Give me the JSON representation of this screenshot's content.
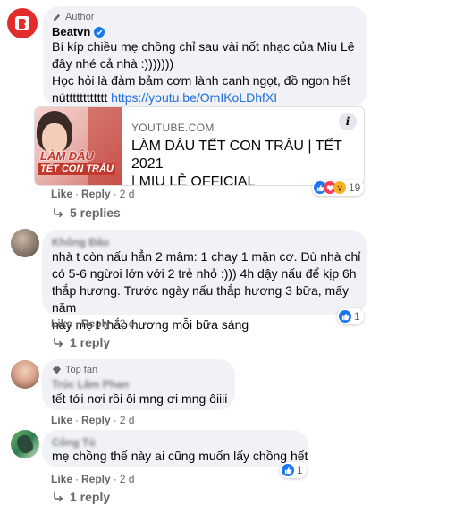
{
  "comment1": {
    "badge": "Author",
    "name": "Beatvn",
    "line1": "Bí kíp chiều mẹ chồng chỉ sau vài nốt nhạc của Miu Lê",
    "line2": "đây nhé cả nhà :)))))))",
    "line3": "Học hỏi là đảm bảm cơm lành canh ngọt, đồ ngon hết",
    "line4_prefix": "nútttttttttttt ",
    "link": "https://youtu.be/OmIKoLDhfXI",
    "preview": {
      "thumb_text_line1": "LÀM DÂU",
      "thumb_text_line2": "TẾT CON TRÂU",
      "domain": "YOUTUBE.COM",
      "title_line1": "LÀM DÂU TẾT CON TRÂU | TẾT 2021",
      "title_line2": "| MIU LÊ OFFICIAL",
      "info_glyph": "i"
    },
    "like": "Like",
    "reply": "Reply",
    "time": "2 d",
    "reactions_count": "19",
    "replies": "5 replies"
  },
  "comment2": {
    "name": "Không Đâu",
    "line1": "nhà t còn nấu hẳn 2 mâm: 1 chay 1 mặn cơ. Dù nhà chỉ",
    "line2": "có 5-6 ngừoi lớn với 2 trẻ nhỏ :))) 4h dậy nấu để kịp 6h",
    "line3": "thắp hương. Trước ngày nấu thắp hương 3 bữa, mấy năm",
    "line4": "nay mẹ t thắp hương mỗi bữa sáng",
    "like": "Like",
    "reply": "Reply",
    "time": "2 d",
    "reactions_count": "1",
    "replies": "1 reply"
  },
  "comment3": {
    "badge": "Top fan",
    "name": "Trúc Lâm Phan",
    "text": "tết tới nơi rồi ôi mng ơi mng ôiiii",
    "like": "Like",
    "reply": "Reply",
    "time": "2 d"
  },
  "comment4": {
    "name": "Công Tú",
    "text": "mẹ chồng thế này ai cũng muốn lấy chồng hết",
    "like": "Like",
    "reply": "Reply",
    "time": "2 d",
    "reactions_count": "1",
    "replies": "1 reply"
  },
  "colors": {
    "bubble": "#f0f2f5",
    "link": "#216fdb",
    "secondary": "#65676b",
    "like_blue": "#1877f2",
    "avatar_red": "#e32d2d"
  }
}
